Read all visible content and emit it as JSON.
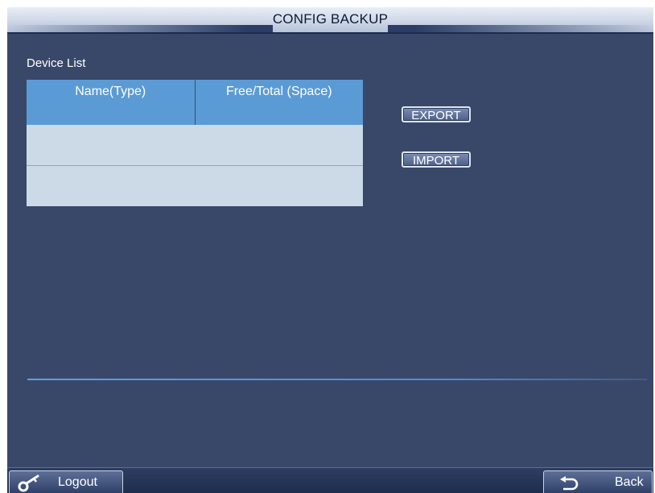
{
  "header": {
    "title": "CONFIG BACKUP"
  },
  "device_list": {
    "label": "Device List",
    "columns": [
      "Name(Type)",
      "Free/Total (Space)"
    ],
    "rows": [
      [
        "",
        ""
      ],
      [
        "",
        ""
      ]
    ]
  },
  "actions": {
    "export_label": "EXPORT",
    "import_label": "IMPORT"
  },
  "footer": {
    "logout_label": "Logout",
    "back_label": "Back"
  },
  "icons": {
    "logout": "key-icon",
    "back": "return-arrow-icon"
  },
  "colors": {
    "background": "#394869",
    "table_header": "#5b9bd5",
    "table_row": "#ccdae7",
    "divider": "#5aa0e6"
  }
}
